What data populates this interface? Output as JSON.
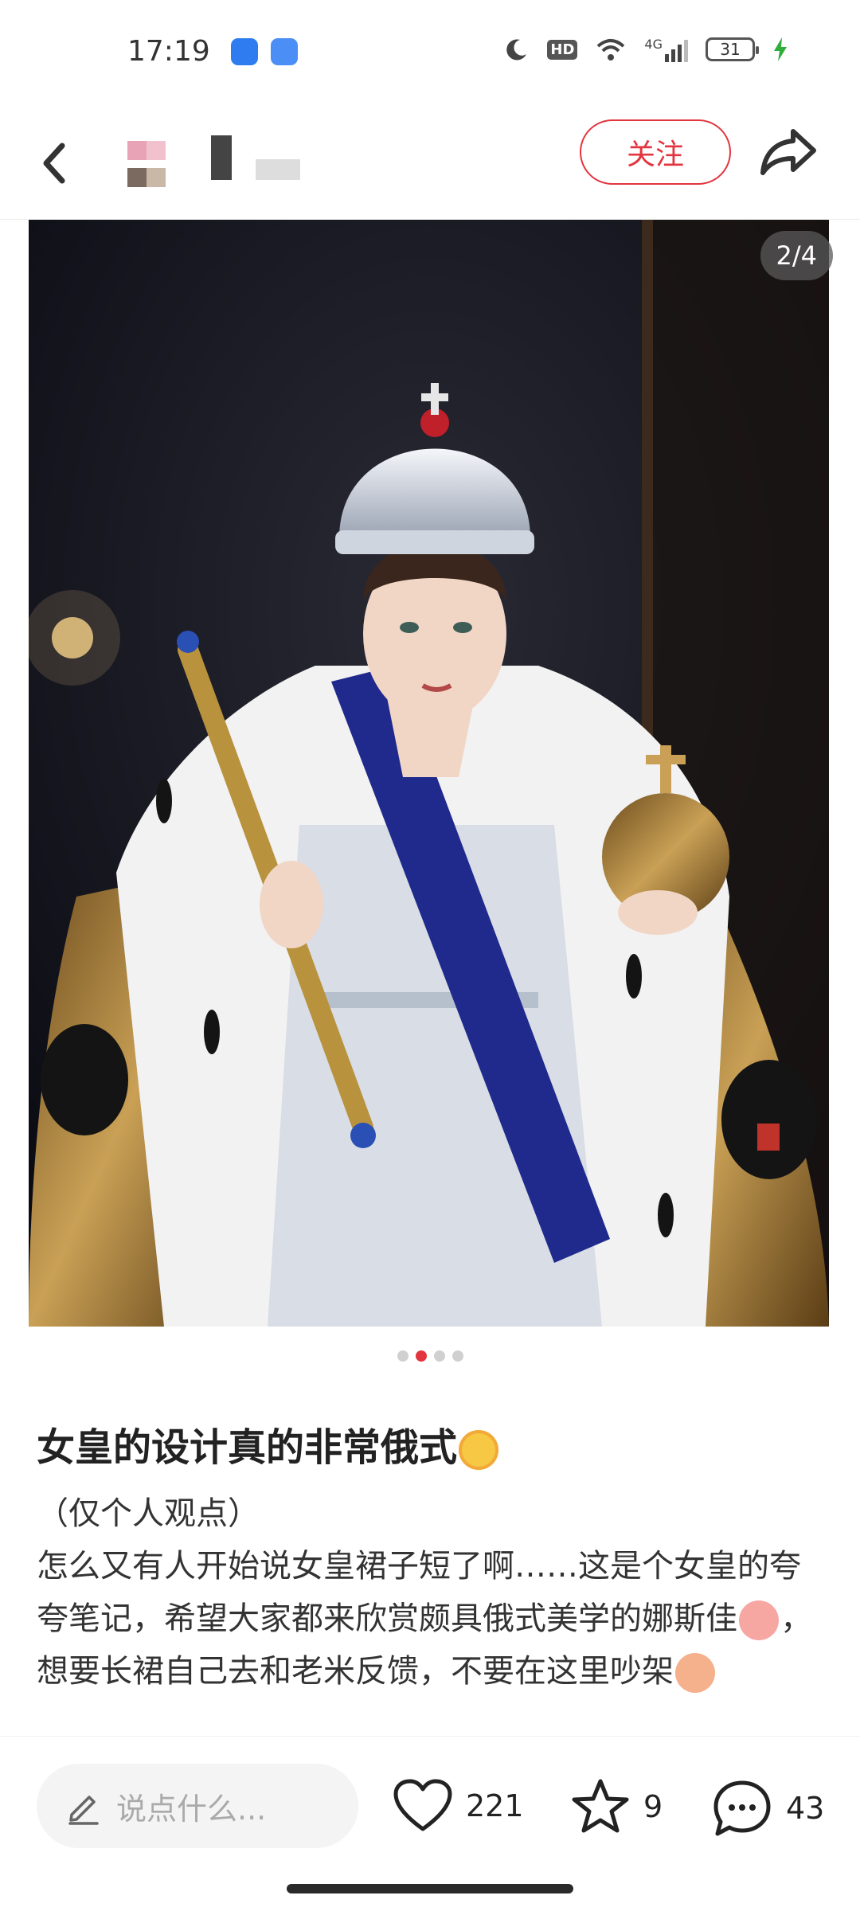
{
  "status_bar": {
    "time": "17:19",
    "network": "4G",
    "hd": "HD",
    "battery": "31"
  },
  "header": {
    "follow_label": "关注"
  },
  "photo": {
    "counter": "2/4",
    "slide_index": 2,
    "slide_total": 4
  },
  "post": {
    "title": "女皇的设计真的非常俄式",
    "line1": "（仅个人观点）",
    "line2_part1": "怎么又有人开始说女皇裙子短了啊……这是个女皇的夸夸笔记，希望大家都来欣赏颇具俄式美学的娜斯佳",
    "line2_part2": "，想要长裙自己去和老米反馈，不要在这里吵架"
  },
  "bottom": {
    "comment_placeholder": "说点什么...",
    "likes": "221",
    "favorites": "9",
    "comments": "43"
  },
  "colors": {
    "accent": "#e2353f"
  },
  "icons": [
    "back-icon",
    "share-icon",
    "heart-icon",
    "star-icon",
    "comment-icon",
    "pen-icon",
    "moon-icon",
    "wifi-icon",
    "signal-icon",
    "charging-icon"
  ]
}
